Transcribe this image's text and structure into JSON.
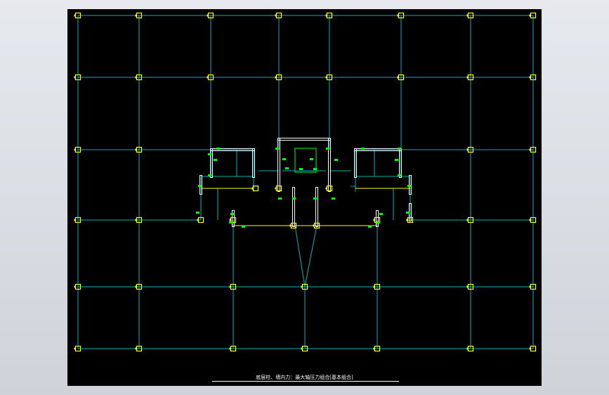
{
  "caption": "底层柱、墙内力：最大轴压力组合[基本组合]",
  "colors": {
    "background": "#000000",
    "grid_beam": "#00b3b3",
    "column": "#ffff00",
    "wall": "#ffffff",
    "label": "#00ff00",
    "frame": "#cfd3d9"
  }
}
